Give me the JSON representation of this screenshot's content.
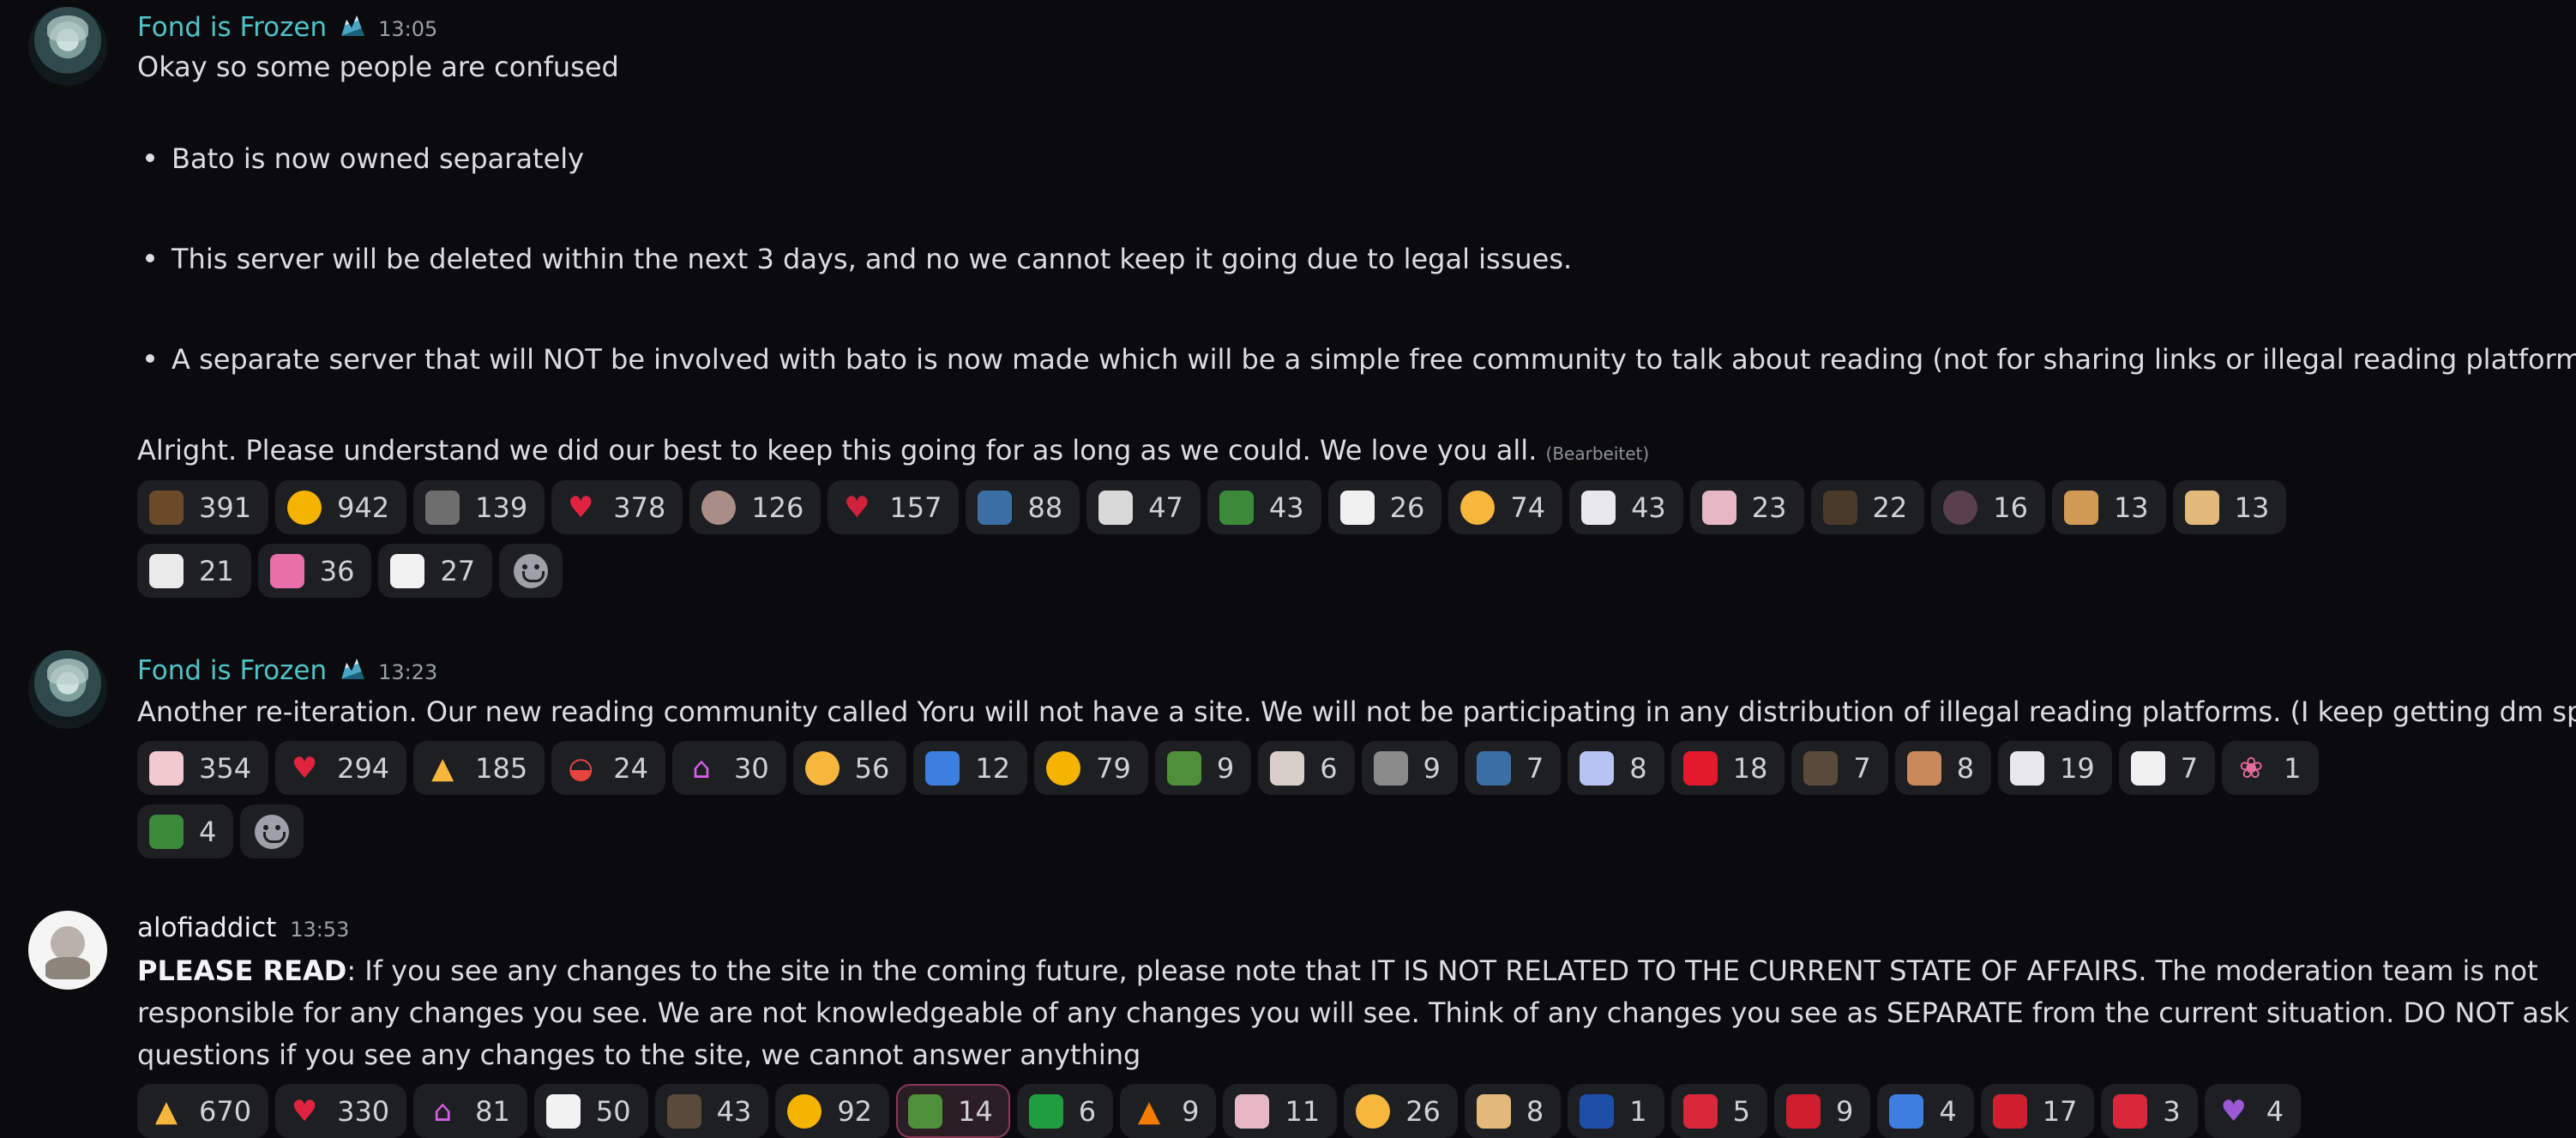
{
  "messages": [
    {
      "author": "Fond is Frozen",
      "time": "13:05",
      "lines": [
        "Okay so some people are confused",
        "Bato is now owned separately",
        "This server will be deleted within the next 3 days, and no we cannot keep it going due to legal issues.",
        "A separate server that will NOT be involved with bato is now made which will be a simple free community to talk about reading (not for sharing links or illegal reading platforms)",
        "Alright. Please understand we did our best to keep this going for as long as we could. We love you all."
      ],
      "edited": "(Bearbeitet)",
      "reactions_row1": [
        {
          "icon": "cat-emoji",
          "count": "391",
          "color": "#6b4a2a"
        },
        {
          "icon": "sob-emoji",
          "count": "942",
          "color": "#f4b400"
        },
        {
          "icon": "cat-photo-emoji",
          "count": "139",
          "color": "#6e6e6e"
        },
        {
          "icon": "heart-emoji",
          "count": "378",
          "color": "#e0243f"
        },
        {
          "icon": "cat-face-emoji",
          "count": "126",
          "color": "#a88e86"
        },
        {
          "icon": "broken-heart-emoji",
          "count": "157",
          "color": "#d0213d"
        },
        {
          "icon": "photo-emoji",
          "count": "88",
          "color": "#3b6ea5"
        },
        {
          "icon": "cat-white-emoji",
          "count": "47",
          "color": "#d8d8d8"
        },
        {
          "icon": "pepe-emoji",
          "count": "43",
          "color": "#3a8a3a"
        },
        {
          "icon": "speech-emoji",
          "count": "26",
          "color": "#f0f0f0"
        },
        {
          "icon": "saluting-face-emoji",
          "count": "74",
          "color": "#f6b73c"
        },
        {
          "icon": "bunny-emoji",
          "count": "43",
          "color": "#e8e8ee"
        },
        {
          "icon": "pink-character-emoji",
          "count": "23",
          "color": "#e6b7c5"
        },
        {
          "icon": "dark-cat-emoji",
          "count": "22",
          "color": "#4a3a2a"
        },
        {
          "icon": "anime-face-emoji",
          "count": "16",
          "color": "#5a3f4f"
        },
        {
          "icon": "tiny-figure-emoji",
          "count": "13",
          "color": "#d19a55"
        },
        {
          "icon": "bread-emoji",
          "count": "13",
          "color": "#e2b97a"
        }
      ],
      "reactions_row2": [
        {
          "icon": "sketch-emoji",
          "count": "21",
          "color": "#eaeaea"
        },
        {
          "icon": "thank-you-emoji",
          "count": "36",
          "color": "#e96fa8"
        },
        {
          "icon": "panda-emoji",
          "count": "27",
          "color": "#f2f2f2"
        }
      ]
    },
    {
      "author": "Fond is Frozen",
      "time": "13:23",
      "lines": [
        "Another re-iteration. Our new reading community called Yoru will not have a site. We will not be participating in any distribution of illegal reading platforms. (I keep getting dm spams)"
      ],
      "reactions_row1": [
        {
          "icon": "bear-emoji",
          "count": "354",
          "color": "#f2c9cf"
        },
        {
          "icon": "heart-emoji",
          "count": "294",
          "color": "#e0243f"
        },
        {
          "icon": "thumbs-up-emoji",
          "count": "185",
          "color": "#f6b73c"
        },
        {
          "icon": "watermelon-emoji",
          "count": "24",
          "color": "#e9433f"
        },
        {
          "icon": "this-emoji",
          "count": "30",
          "color": "#d45ee6"
        },
        {
          "icon": "saluting-face-emoji",
          "count": "56",
          "color": "#f6b73c"
        },
        {
          "icon": "blue-mask-emoji",
          "count": "12",
          "color": "#3d7fe0"
        },
        {
          "icon": "sob-emoji",
          "count": "79",
          "color": "#f4b400"
        },
        {
          "icon": "frog-emoji",
          "count": "9",
          "color": "#4f8f3a"
        },
        {
          "icon": "cat-photo-emoji",
          "count": "6",
          "color": "#d8cfc8"
        },
        {
          "icon": "grey-cat-emoji",
          "count": "9",
          "color": "#8a8a8a"
        },
        {
          "icon": "photo-emoji",
          "count": "7",
          "color": "#3b6ea5"
        },
        {
          "icon": "hat-cat-emoji",
          "count": "8",
          "color": "#b7c3f0"
        },
        {
          "icon": "indonesia-flag-emoji",
          "count": "18",
          "color": "#e3192c"
        },
        {
          "icon": "dark-cat-emoji",
          "count": "7",
          "color": "#5a4a3a"
        },
        {
          "icon": "anime-girl-emoji",
          "count": "8",
          "color": "#c9895a"
        },
        {
          "icon": "bunny-emoji",
          "count": "19",
          "color": "#e8e8ee"
        },
        {
          "icon": "cute-cat-emoji",
          "count": "7",
          "color": "#f0f0f0"
        },
        {
          "icon": "tulip-emoji",
          "count": "1",
          "color": "#e56aa0"
        }
      ],
      "reactions_row2": [
        {
          "icon": "pepe-emoji",
          "count": "4",
          "color": "#3a8a3a"
        }
      ]
    },
    {
      "author": "alofiaddict",
      "time": "13:53",
      "bold_prefix": "PLEASE READ",
      "lines": [
        ": If you see any changes to the site in the coming future, please note that IT IS NOT RELATED TO THE CURRENT STATE OF AFFAIRS. The moderation team is not",
        "responsible for any changes you see. We are not knowledgeable of any changes you will see. Think of any changes you see as SEPARATE from the current situation. DO NOT ask us any",
        "questions if you see any changes to the site, we cannot answer anything"
      ],
      "reactions_row1": [
        {
          "icon": "thumbs-up-emoji",
          "count": "670",
          "color": "#f6b73c"
        },
        {
          "icon": "heart-emoji",
          "count": "330",
          "color": "#e0243f"
        },
        {
          "icon": "this-emoji",
          "count": "81",
          "color": "#d45ee6"
        },
        {
          "icon": "panda-emoji",
          "count": "50",
          "color": "#f2f2f2"
        },
        {
          "icon": "dark-cat-emoji",
          "count": "43",
          "color": "#5a4a3a"
        },
        {
          "icon": "sob-emoji",
          "count": "92",
          "color": "#f4b400"
        },
        {
          "icon": "frog-emoji",
          "count": "14",
          "color": "#4f8f3a",
          "active": true
        },
        {
          "icon": "brazil-flag-emoji",
          "count": "6",
          "color": "#1f9d3f"
        },
        {
          "icon": "fire-emoji",
          "count": "9",
          "color": "#f57c00"
        },
        {
          "icon": "pink-character-emoji",
          "count": "11",
          "color": "#e6b7c5"
        },
        {
          "icon": "saluting-face-emoji",
          "count": "26",
          "color": "#f6b73c"
        },
        {
          "icon": "bread-emoji",
          "count": "8",
          "color": "#e2b97a"
        },
        {
          "icon": "bosnia-flag-emoji",
          "count": "1",
          "color": "#1d4fa8"
        },
        {
          "icon": "flag-emoji",
          "count": "5",
          "color": "#d9283a"
        },
        {
          "icon": "palestine-flag-emoji",
          "count": "9",
          "color": "#cf1f2e"
        },
        {
          "icon": "blue-mask-emoji",
          "count": "4",
          "color": "#3d7fe0"
        },
        {
          "icon": "red-flag-emoji",
          "count": "17",
          "color": "#d0202f"
        },
        {
          "icon": "pennant-emoji",
          "count": "3",
          "color": "#d9283a"
        },
        {
          "icon": "purple-heart-emoji",
          "count": "4",
          "color": "#9b59d6"
        }
      ]
    }
  ]
}
